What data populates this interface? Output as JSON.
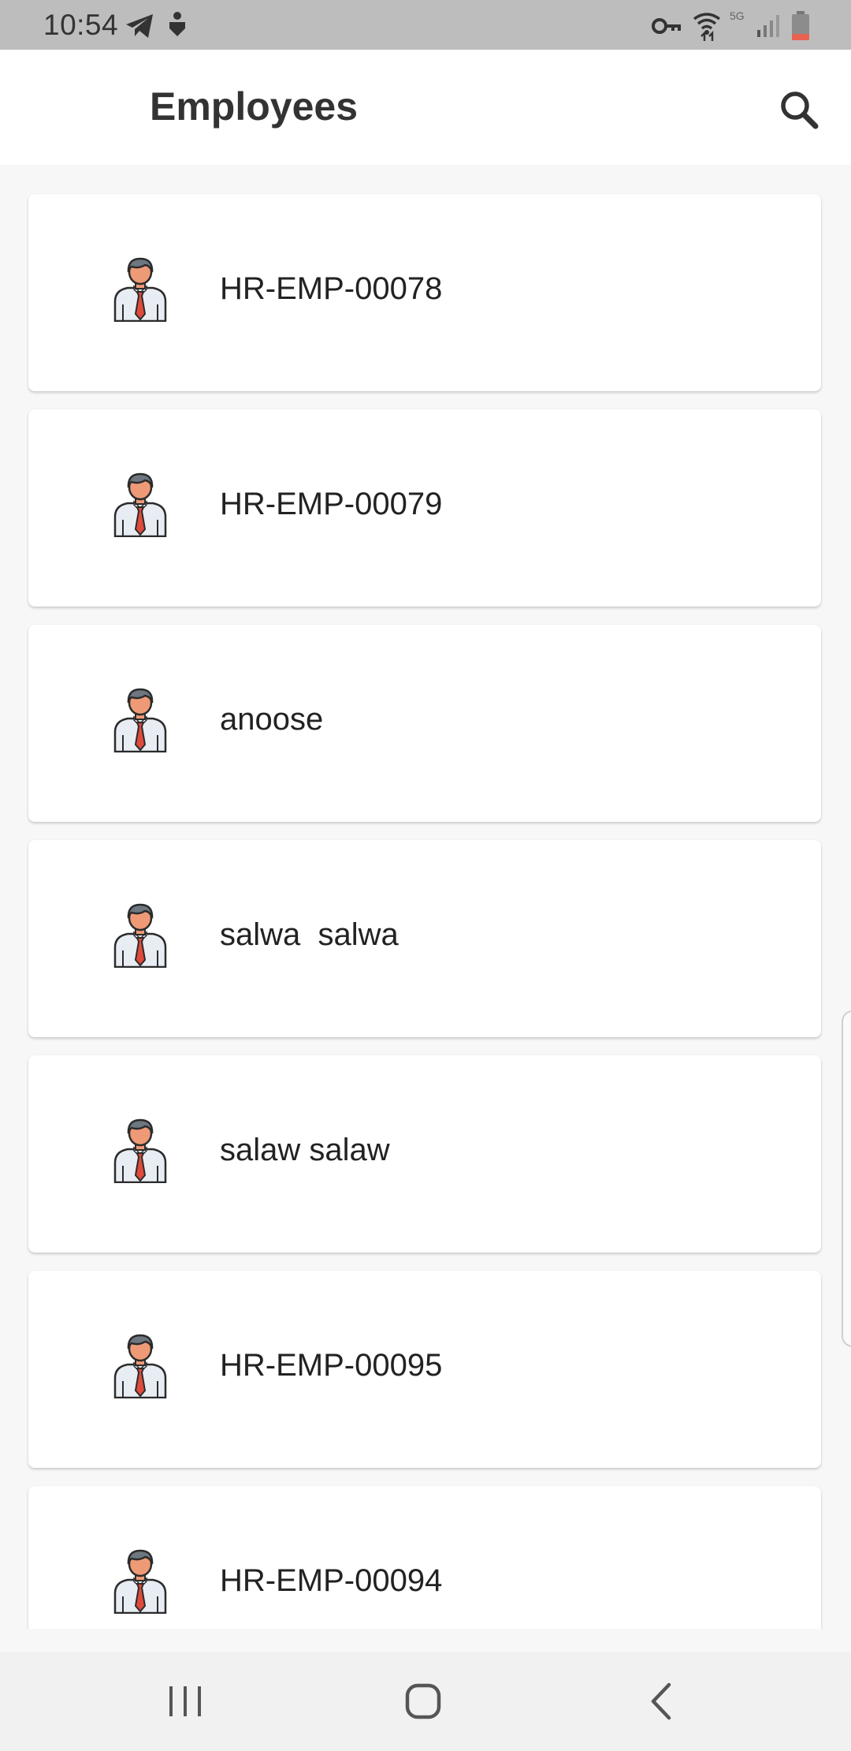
{
  "status_bar": {
    "time": "10:54",
    "icons": [
      "telegram-icon",
      "download-arrow-icon",
      "vpn-key-icon",
      "wifi-icon",
      "5g-icon",
      "signal-icon",
      "battery-icon"
    ],
    "network_label": "5G"
  },
  "app_bar": {
    "title": "Employees",
    "search_icon": "search-icon"
  },
  "employees": [
    {
      "name": "HR-EMP-00078",
      "avatar": "employee-avatar-icon"
    },
    {
      "name": "HR-EMP-00079",
      "avatar": "employee-avatar-icon"
    },
    {
      "name": "anoose",
      "avatar": "employee-avatar-icon"
    },
    {
      "name": "salwa  salwa",
      "avatar": "employee-avatar-icon"
    },
    {
      "name": "salaw salaw",
      "avatar": "employee-avatar-icon"
    },
    {
      "name": "HR-EMP-00095",
      "avatar": "employee-avatar-icon"
    },
    {
      "name": "HR-EMP-00094",
      "avatar": "employee-avatar-icon"
    }
  ],
  "nav_bar": {
    "icons": [
      "recent-apps-icon",
      "home-icon",
      "back-icon"
    ]
  },
  "colors": {
    "status_bar_bg": "#bdbdbd",
    "app_bar_bg": "#ffffff",
    "page_bg": "#f7f7f7",
    "card_bg": "#ffffff",
    "avatar_tie": "#e04a3c",
    "avatar_skin": "#ef9a76",
    "avatar_hair": "#6e7780",
    "battery_low": "#e8624f"
  }
}
